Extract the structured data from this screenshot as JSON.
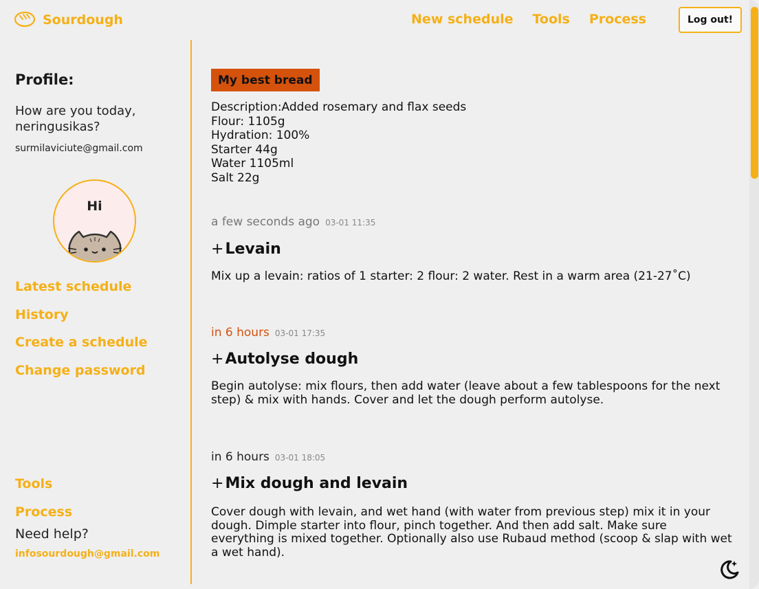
{
  "header": {
    "brand": "Sourdough",
    "nav": [
      "New schedule",
      "Tools",
      "Process"
    ],
    "logout_label": "Log out!"
  },
  "sidebar": {
    "profile_title": "Profile:",
    "greeting": "How are you today, neringusikas?",
    "email": "surmilaviciute@gmail.com",
    "avatar_text": "Hi",
    "links": [
      "Latest schedule",
      "History",
      "Create a schedule",
      "Change password"
    ],
    "footer_links": [
      "Tools",
      "Process"
    ],
    "need_help": "Need help?",
    "help_email": "infosourdough@gmail.com"
  },
  "recipe": {
    "name": "My best bread",
    "description_lines": [
      "Description:Added rosemary and flax seeds",
      "Flour: 1105g",
      "Hydration: 100%",
      "Starter 44g",
      "Water 1105ml",
      "Salt 22g"
    ]
  },
  "steps": [
    {
      "relative_time": "a few seconds ago",
      "date": "03-01 11:35",
      "title": "Levain",
      "description": "Mix up a levain: ratios of 1 starter: 2 flour: 2 water. Rest in a warm area (21-27˚C)"
    },
    {
      "relative_time": "in 6 hours",
      "date": "03-01 17:35",
      "title": "Autolyse dough",
      "description": "Begin autolyse: mix flours, then add water (leave about a few tablespoons for the next step) & mix with hands. Cover and let the dough perform autolyse."
    },
    {
      "relative_time": "in 6 hours",
      "date": "03-01 18:05",
      "title": "Mix dough and levain",
      "description": "Cover dough with levain, and wet hand (with water from previous step) mix it in your dough. Dimple starter into flour, pinch together. And then add salt. Make sure everything is mixed together. Optionally also use Rubaud method (scoop & slap with wet a wet hand)."
    }
  ],
  "colors": {
    "accent": "#f5b017",
    "recipe_badge": "#d4520c",
    "upcoming_time": "#d4520c",
    "background": "#efefef"
  },
  "icons": {
    "logo": "bread-icon",
    "avatar": "cat-avatar",
    "theme_toggle": "moon-sparkle-icon"
  }
}
